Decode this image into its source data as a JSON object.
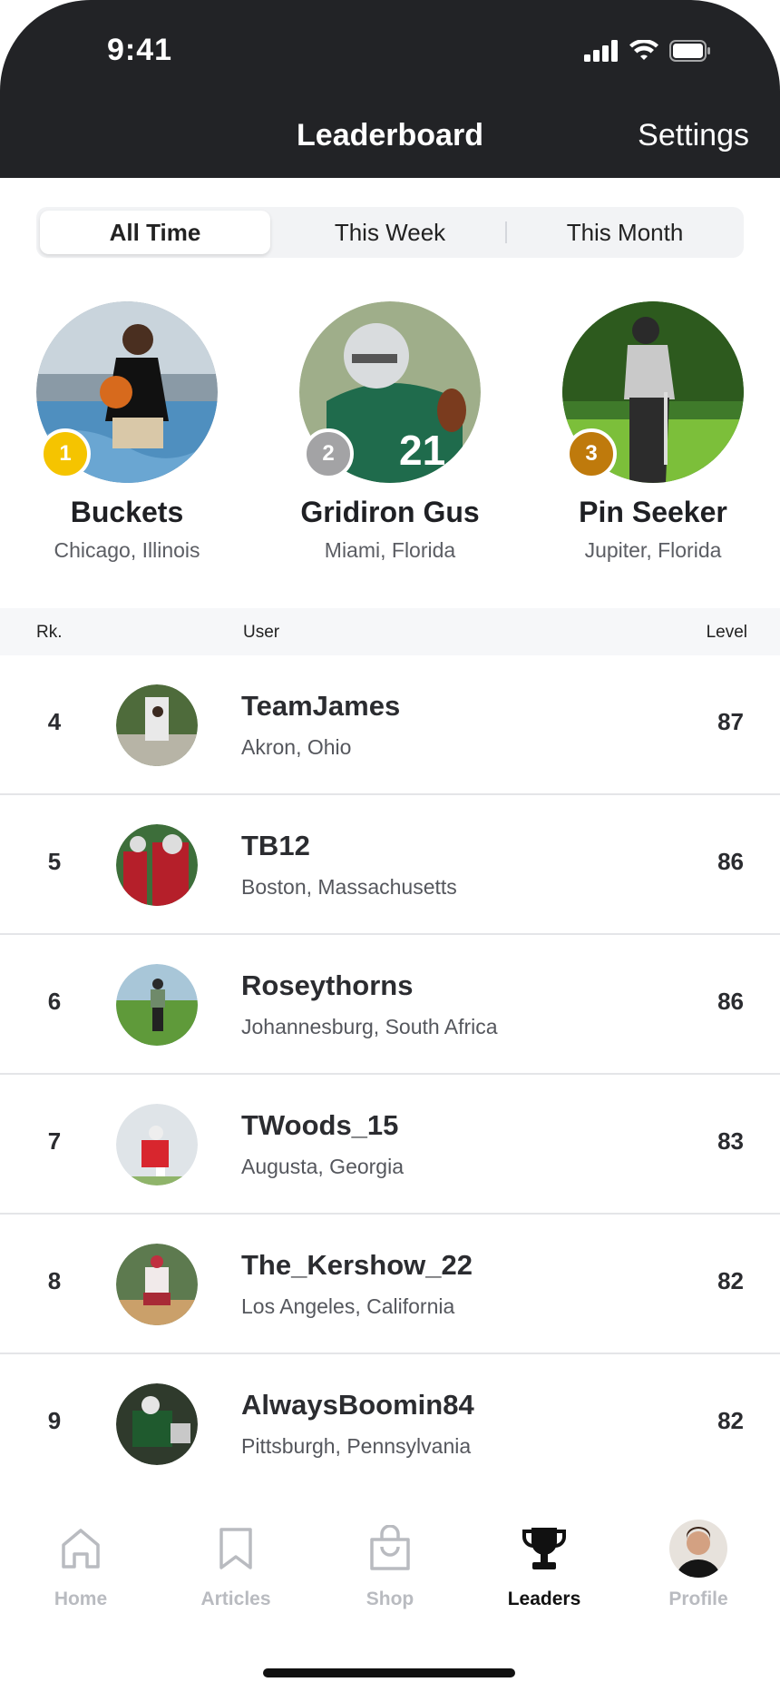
{
  "status_bar": {
    "time": "9:41"
  },
  "nav": {
    "title": "Leaderboard",
    "settings_label": "Settings"
  },
  "segments": [
    {
      "label": "All Time",
      "selected": true
    },
    {
      "label": "This Week",
      "selected": false
    },
    {
      "label": "This Month",
      "selected": false
    }
  ],
  "podium": [
    {
      "rank": "1",
      "name": "Buckets",
      "location": "Chicago, Illinois",
      "badge_color": "#f5c400"
    },
    {
      "rank": "2",
      "name": "Gridiron Gus",
      "location": "Miami, Florida",
      "badge_color": "#a3a3a5"
    },
    {
      "rank": "3",
      "name": "Pin Seeker",
      "location": "Jupiter, Florida",
      "badge_color": "#bf7a0c"
    }
  ],
  "table_header": {
    "rank": "Rk.",
    "user": "User",
    "level": "Level"
  },
  "rows": [
    {
      "rank": "4",
      "name": "TeamJames",
      "location": "Akron, Ohio",
      "level": "87"
    },
    {
      "rank": "5",
      "name": "TB12",
      "location": "Boston, Massachusetts",
      "level": "86"
    },
    {
      "rank": "6",
      "name": "Roseythorns",
      "location": "Johannesburg, South Africa",
      "level": "86"
    },
    {
      "rank": "7",
      "name": "TWoods_15",
      "location": "Augusta, Georgia",
      "level": "83"
    },
    {
      "rank": "8",
      "name": "The_Kershow_22",
      "location": "Los Angeles, California",
      "level": "82"
    },
    {
      "rank": "9",
      "name": "AlwaysBoomin84",
      "location": "Pittsburgh, Pennsylvania",
      "level": "82"
    }
  ],
  "tabs": [
    {
      "label": "Home",
      "icon": "home-icon",
      "active": false
    },
    {
      "label": "Articles",
      "icon": "bookmark-icon",
      "active": false
    },
    {
      "label": "Shop",
      "icon": "shopping-bag-icon",
      "active": false
    },
    {
      "label": "Leaders",
      "icon": "trophy-icon",
      "active": true
    },
    {
      "label": "Profile",
      "icon": "avatar",
      "active": false
    }
  ],
  "colors": {
    "header_bg": "#222326",
    "accent_gold": "#f5c400",
    "silver": "#a3a3a5",
    "bronze": "#bf7a0c"
  }
}
